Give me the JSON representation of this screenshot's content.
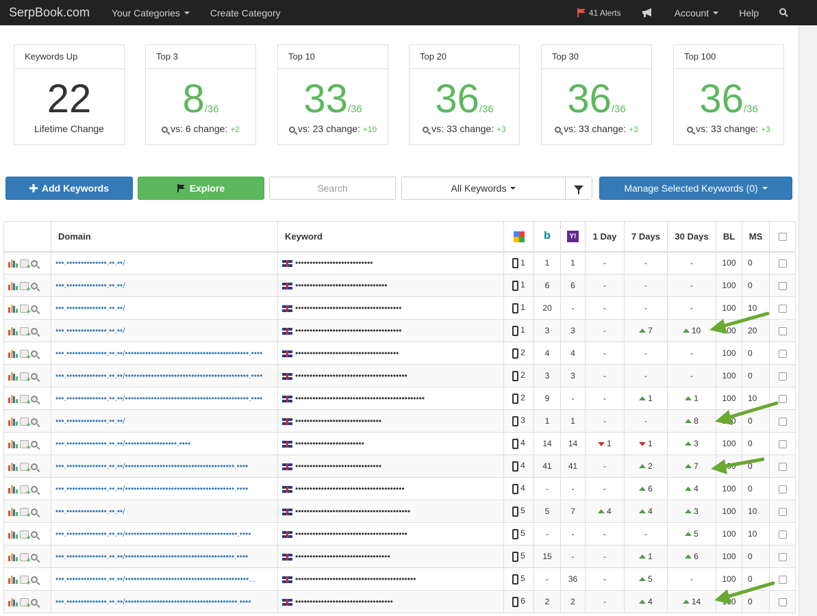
{
  "nav": {
    "brand": "SerpBook.com",
    "categories": "Your Categories",
    "create": "Create Category",
    "alerts": "41 Alerts",
    "account": "Account",
    "help": "Help"
  },
  "stats": [
    {
      "title": "Keywords Up",
      "value": "22",
      "of": "",
      "foot": "Lifetime Change",
      "vs": "",
      "change": ""
    },
    {
      "title": "Top 3",
      "value": "8",
      "of": "/36",
      "foot": "vs: 6 change: ",
      "change": "+2"
    },
    {
      "title": "Top 10",
      "value": "33",
      "of": "/36",
      "foot": "vs: 23 change: ",
      "change": "+10"
    },
    {
      "title": "Top 20",
      "value": "36",
      "of": "/36",
      "foot": "vs: 33 change: ",
      "change": "+3"
    },
    {
      "title": "Top 30",
      "value": "36",
      "of": "/36",
      "foot": "vs: 33 change: ",
      "change": "+3"
    },
    {
      "title": "Top 100",
      "value": "36",
      "of": "/36",
      "foot": "vs: 33 change: ",
      "change": "+3"
    }
  ],
  "toolbar": {
    "add": "Add Keywords",
    "explore": "Explore",
    "search_placeholder": "Search",
    "filter": "All Keywords",
    "manage": "Manage Selected Keywords (0)"
  },
  "table": {
    "headers": {
      "domain": "Domain",
      "keyword": "Keyword",
      "d1": "1 Day",
      "d7": "7 Days",
      "d30": "30 Days",
      "bl": "BL",
      "ms": "MS"
    },
    "rows": [
      {
        "domain": "•••.••••••••••••••.••.••/",
        "keyword": "•••••••••••••••••••••••••••",
        "google": "1",
        "bing": "1",
        "yahoo": "1",
        "d1": "-",
        "d1dir": "",
        "d7": "-",
        "d7dir": "",
        "d30": "-",
        "d30dir": "",
        "bl": "100",
        "ms": "0"
      },
      {
        "domain": "•••.••••••••••••••.••.••/",
        "keyword": "••••••••••••••••••••••••••••••••",
        "google": "1",
        "bing": "6",
        "yahoo": "6",
        "d1": "-",
        "d1dir": "",
        "d7": "-",
        "d7dir": "",
        "d30": "-",
        "d30dir": "",
        "bl": "100",
        "ms": "0"
      },
      {
        "domain": "•••.••••••••••••••.••.••/",
        "keyword": "•••••••••••••••••••••••••••••••••••••",
        "google": "1",
        "bing": "20",
        "yahoo": "-",
        "d1": "-",
        "d1dir": "",
        "d7": "-",
        "d7dir": "",
        "d30": "-",
        "d30dir": "",
        "bl": "100",
        "ms": "10"
      },
      {
        "domain": "•••.••••••••••••••.••.••/",
        "keyword": "•••••••••••••••••••••••••••••••••••••",
        "google": "1",
        "bing": "3",
        "yahoo": "3",
        "d1": "-",
        "d1dir": "",
        "d7": "7",
        "d7dir": "up",
        "d30": "10",
        "d30dir": "up",
        "bl": "100",
        "ms": "20"
      },
      {
        "domain": "•••.••••••••••••••.••.••/•••••••••••••••••••••••••••••••••••••••••••.••••",
        "keyword": "••••••••••••••••••••••••••••••••••••",
        "google": "2",
        "bing": "4",
        "yahoo": "4",
        "d1": "-",
        "d1dir": "",
        "d7": "-",
        "d7dir": "",
        "d30": "-",
        "d30dir": "",
        "bl": "100",
        "ms": "0"
      },
      {
        "domain": "•••.••••••••••••••.••.••/•••••••••••••••••••••••••••••••••••••••••••.••••",
        "keyword": "•••••••••••••••••••••••••••••••••••••••",
        "google": "2",
        "bing": "3",
        "yahoo": "3",
        "d1": "-",
        "d1dir": "",
        "d7": "-",
        "d7dir": "",
        "d30": "-",
        "d30dir": "",
        "bl": "100",
        "ms": "0"
      },
      {
        "domain": "•••.••••••••••••••.••.••/•••••••••••••••••••••••••••••••••••••••••••.••••",
        "keyword": "•••••••••••••••••••••••••••••••••••••••••••••",
        "google": "2",
        "bing": "9",
        "yahoo": "-",
        "d1": "-",
        "d1dir": "",
        "d7": "1",
        "d7dir": "up",
        "d30": "1",
        "d30dir": "up",
        "bl": "100",
        "ms": "10"
      },
      {
        "domain": "•••.••••••••••••••.••.••/",
        "keyword": "••••••••••••••••••••••••••••••",
        "google": "3",
        "bing": "1",
        "yahoo": "1",
        "d1": "-",
        "d1dir": "",
        "d7": "-",
        "d7dir": "",
        "d30": "8",
        "d30dir": "up",
        "bl": "100",
        "ms": "0"
      },
      {
        "domain": "•••.••••••••••••••.••.••/••••••••••••••••••.••••",
        "keyword": "••••••••••••••••••••••••",
        "google": "4",
        "bing": "14",
        "yahoo": "14",
        "d1": "1",
        "d1dir": "down",
        "d7": "1",
        "d7dir": "down",
        "d30": "3",
        "d30dir": "up",
        "bl": "100",
        "ms": "0"
      },
      {
        "domain": "•••.••••••••••••••.••.••/••••••••••••••••••••••••••••••••••••••.••••",
        "keyword": "••••••••••••••••••••••••••••••",
        "google": "4",
        "bing": "41",
        "yahoo": "41",
        "d1": "-",
        "d1dir": "",
        "d7": "2",
        "d7dir": "up",
        "d30": "7",
        "d30dir": "up",
        "bl": "100",
        "ms": "0"
      },
      {
        "domain": "•••.••••••••••••••.••.••/••••••••••••••••••••••••••••••••••••••.••••",
        "keyword": "••••••••••••••••••••••••••••••••••••••",
        "google": "4",
        "bing": "-",
        "yahoo": "-",
        "d1": "-",
        "d1dir": "",
        "d7": "6",
        "d7dir": "up",
        "d30": "4",
        "d30dir": "up",
        "bl": "100",
        "ms": "0"
      },
      {
        "domain": "•••.••••••••••••••.••.••/",
        "keyword": "••••••••••••••••••••••••••••••••••••••••",
        "google": "5",
        "bing": "5",
        "yahoo": "7",
        "d1": "4",
        "d1dir": "up",
        "d7": "4",
        "d7dir": "up",
        "d30": "3",
        "d30dir": "up",
        "bl": "100",
        "ms": "10"
      },
      {
        "domain": "•••.••••••••••••••.••.••/•••••••••••••••••••••••••••••••••••••••.••••",
        "keyword": "•••••••••••••••••••••••••••••••••••••••",
        "google": "5",
        "bing": "-",
        "yahoo": "-",
        "d1": "-",
        "d1dir": "",
        "d7": "-",
        "d7dir": "",
        "d30": "5",
        "d30dir": "up",
        "bl": "100",
        "ms": "10"
      },
      {
        "domain": "•••.••••••••••••••.••.••/••••••••••••••••••••••••••••••••••••••.••••",
        "keyword": "•••••••••••••••••••••••••••••••••",
        "google": "5",
        "bing": "15",
        "yahoo": "-",
        "d1": "-",
        "d1dir": "",
        "d7": "1",
        "d7dir": "up",
        "d30": "6",
        "d30dir": "up",
        "bl": "100",
        "ms": "0"
      },
      {
        "domain": "•••.••••••••••••••.••.••/•••••••••••••••••••••••••••••••••••••••••••...",
        "keyword": "••••••••••••••••••••••••••••••••••••••••••",
        "google": "5",
        "bing": "-",
        "yahoo": "36",
        "d1": "-",
        "d1dir": "",
        "d7": "5",
        "d7dir": "up",
        "d30": "-",
        "d30dir": "",
        "bl": "100",
        "ms": "0"
      },
      {
        "domain": "•••.••••••••••••••.••.••/•••••••••••••••••••••••••••••••••••••••.••••",
        "keyword": "••••••••••••••••••••••••••••••••••",
        "google": "6",
        "bing": "2",
        "yahoo": "2",
        "d1": "-",
        "d1dir": "",
        "d7": "4",
        "d7dir": "up",
        "d30": "14",
        "d30dir": "up",
        "bl": "100",
        "ms": "0"
      }
    ]
  }
}
